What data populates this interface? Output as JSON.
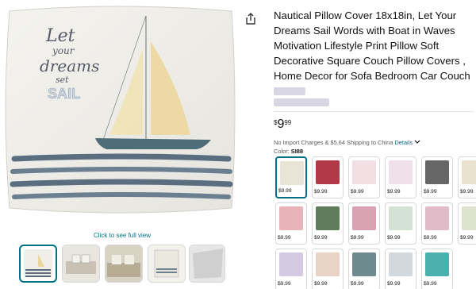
{
  "product": {
    "title": "Nautical Pillow Cover 18x18in, Let Your Dreams Sail Words with Boat in Waves Motivation Lifestyle Print Pillow Soft Decorative Square Couch Pillow Covers , Home Decor for Sofa Bedroom Car Couch",
    "price_currency": "$",
    "price_whole": "9",
    "price_cents": "99",
    "charges_text": "No Import Charges & $5.64 Shipping to China",
    "details_label": "Details",
    "color_label": "Color:",
    "color_value": "SI88"
  },
  "image": {
    "line1": "Let",
    "line2": "your",
    "line3": "dreams",
    "line4": "set",
    "line5": "SAIL",
    "view_link": "Click to see full view"
  },
  "icons": {
    "share": "share-icon",
    "chevron": "chevron-down-icon"
  },
  "swatches": [
    {
      "price": "$9.99",
      "color": "#e8e4d6"
    },
    {
      "price": "$9.99",
      "color": "#b03a48"
    },
    {
      "price": "$9.99",
      "color": "#f1dfe4"
    },
    {
      "price": "$9.99",
      "color": "#efe0ea"
    },
    {
      "price": "$9.99",
      "color": "#666666"
    },
    {
      "price": "$9.99",
      "color": "#e8e2cf"
    },
    {
      "price": "$9.99",
      "color": "#e9b4b8"
    },
    {
      "price": "$9.99",
      "color": "#5f7d5a"
    },
    {
      "price": "$9.99",
      "color": "#d8a2b2"
    },
    {
      "price": "$9.99",
      "color": "#d3e2d5"
    },
    {
      "price": "$9.99",
      "color": "#e1bcc8"
    },
    {
      "price": "$9.99",
      "color": "#dde3cf"
    },
    {
      "price": "$9.99",
      "color": "#d6c9e2"
    },
    {
      "price": "$9.99",
      "color": "#e8d3c4"
    },
    {
      "price": "$9.99",
      "color": "#6e8a8c"
    },
    {
      "price": "$9.99",
      "color": "#d3d8dc"
    },
    {
      "price": "$9.99",
      "color": "#4bb0b0"
    }
  ]
}
